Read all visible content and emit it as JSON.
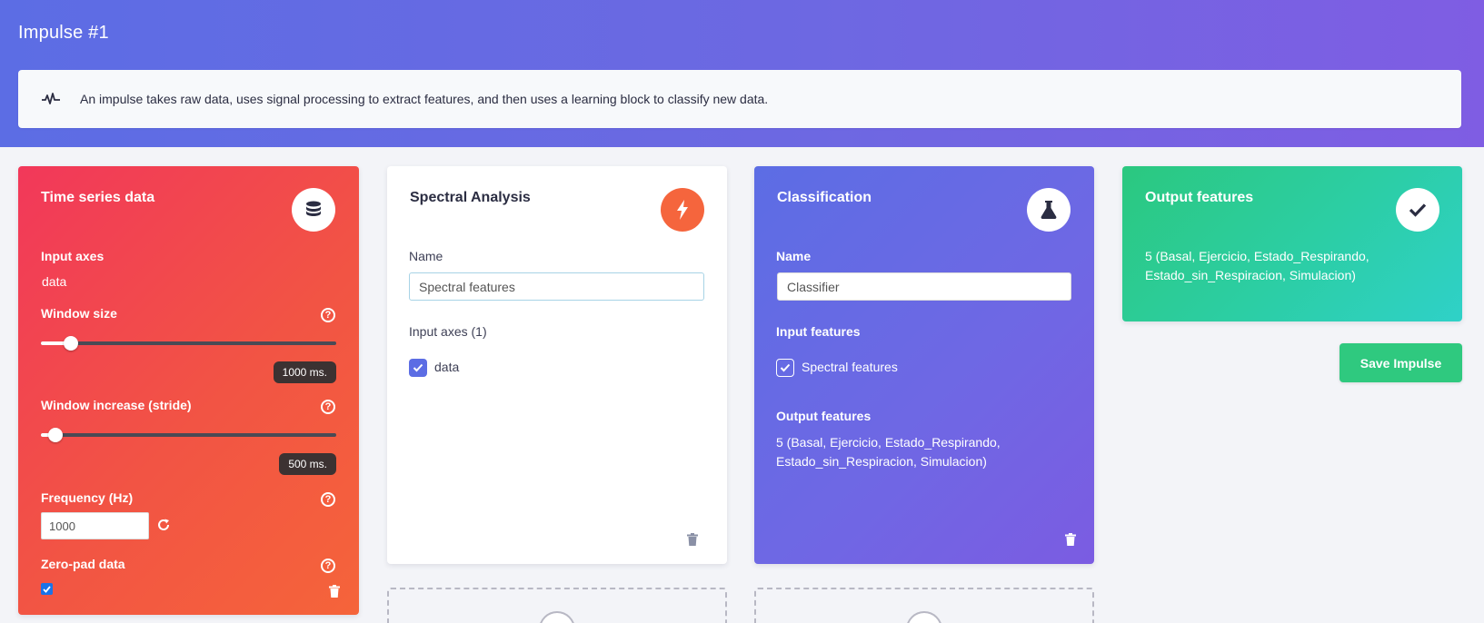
{
  "page": {
    "title": "Impulse #1"
  },
  "info": {
    "text": "An impulse takes raw data, uses signal processing to extract features, and then uses a learning block to classify new data."
  },
  "time_series": {
    "title": "Time series data",
    "icon": "database-icon",
    "input_axes_label": "Input axes",
    "input_axes_value": "data",
    "window_size_label": "Window size",
    "window_size_value": "1000 ms.",
    "window_size_fraction": 0.1,
    "window_increase_label": "Window increase (stride)",
    "window_increase_value": "500 ms.",
    "window_increase_fraction": 0.05,
    "frequency_label": "Frequency (Hz)",
    "frequency_value": "1000",
    "zero_pad_label": "Zero-pad data",
    "zero_pad_checked": true,
    "help_glyph": "?"
  },
  "spectral": {
    "title": "Spectral Analysis",
    "icon": "bolt-icon",
    "name_label": "Name",
    "name_value": "Spectral features",
    "input_axes_label": "Input axes (1)",
    "axes": [
      {
        "label": "data",
        "checked": true
      }
    ]
  },
  "classification": {
    "title": "Classification",
    "icon": "flask-icon",
    "name_label": "Name",
    "name_value": "Classifier",
    "input_features_label": "Input features",
    "features": [
      {
        "label": "Spectral features",
        "checked": true
      }
    ],
    "output_features_label": "Output features",
    "output_features_line1": "5 (Basal, Ejercicio, Estado_Respirando,",
    "output_features_line2": "Estado_sin_Respiracion, Simulacion)"
  },
  "output": {
    "title": "Output features",
    "icon": "check-icon",
    "line1": "5 (Basal, Ejercicio, Estado_Respirando,",
    "line2": "Estado_sin_Respiracion, Simulacion)"
  },
  "actions": {
    "save_label": "Save Impulse"
  },
  "colors": {
    "hero": "#6a69e3",
    "time_series": "#f2455a",
    "spectral_badge": "#f5653d",
    "classification": "#6a6ae4",
    "output": "#2dcda4",
    "save": "#2fc97f"
  }
}
